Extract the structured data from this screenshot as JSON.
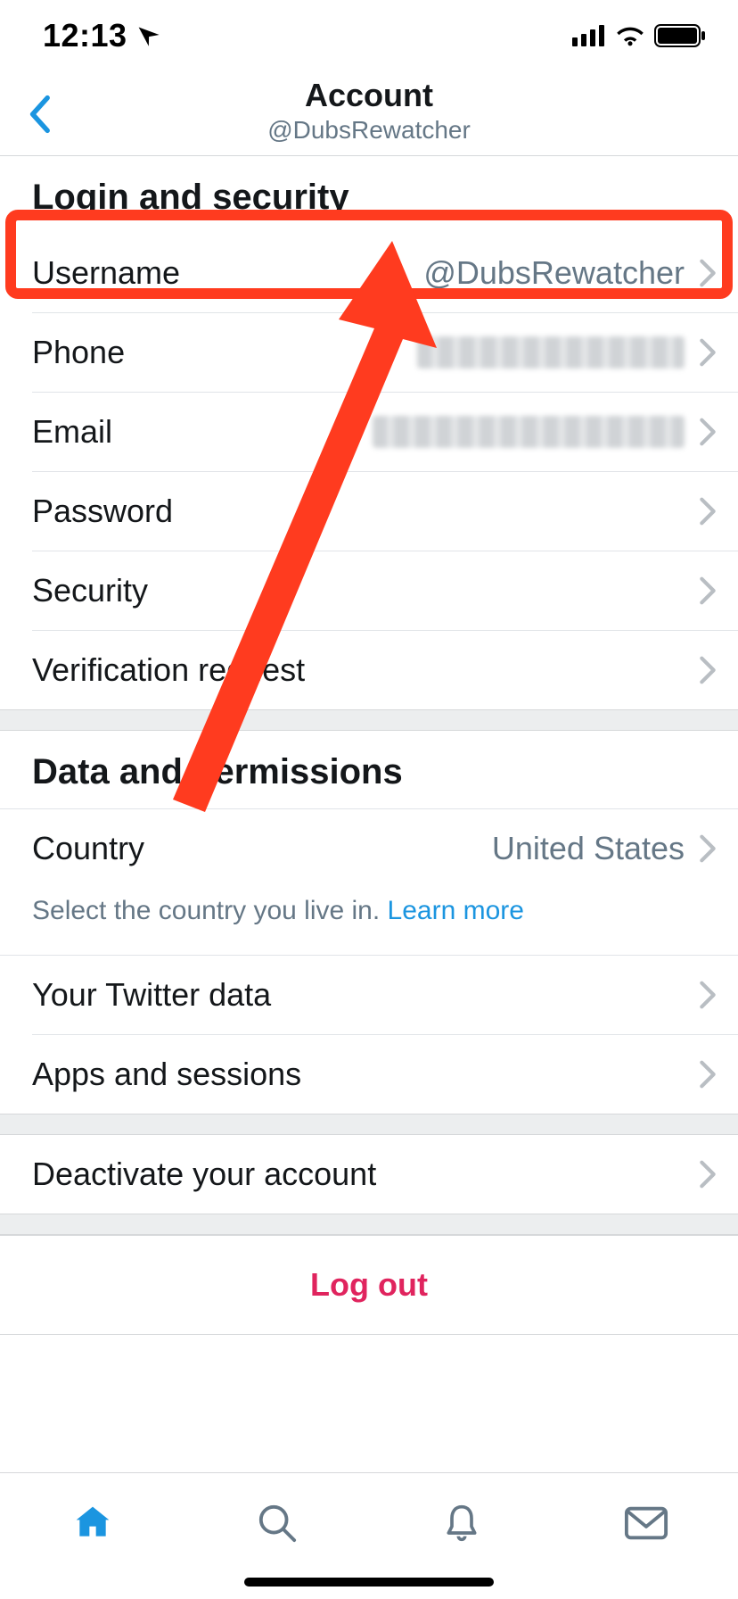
{
  "status": {
    "time": "12:13"
  },
  "header": {
    "title": "Account",
    "subtitle": "@DubsRewatcher"
  },
  "sections": {
    "login": {
      "title": "Login and security",
      "rows": {
        "username": {
          "label": "Username",
          "value": "@DubsRewatcher"
        },
        "phone": {
          "label": "Phone"
        },
        "email": {
          "label": "Email"
        },
        "password": {
          "label": "Password"
        },
        "security": {
          "label": "Security"
        },
        "verification": {
          "label": "Verification request"
        }
      }
    },
    "data": {
      "title": "Data and permissions",
      "rows": {
        "country": {
          "label": "Country",
          "value": "United States",
          "helper_pre": "Select the country you live in. ",
          "helper_link": "Learn more"
        },
        "twitter_data": {
          "label": "Your Twitter data"
        },
        "apps": {
          "label": "Apps and sessions"
        }
      }
    },
    "deactivate": {
      "label": "Deactivate your account"
    }
  },
  "logout": "Log out"
}
